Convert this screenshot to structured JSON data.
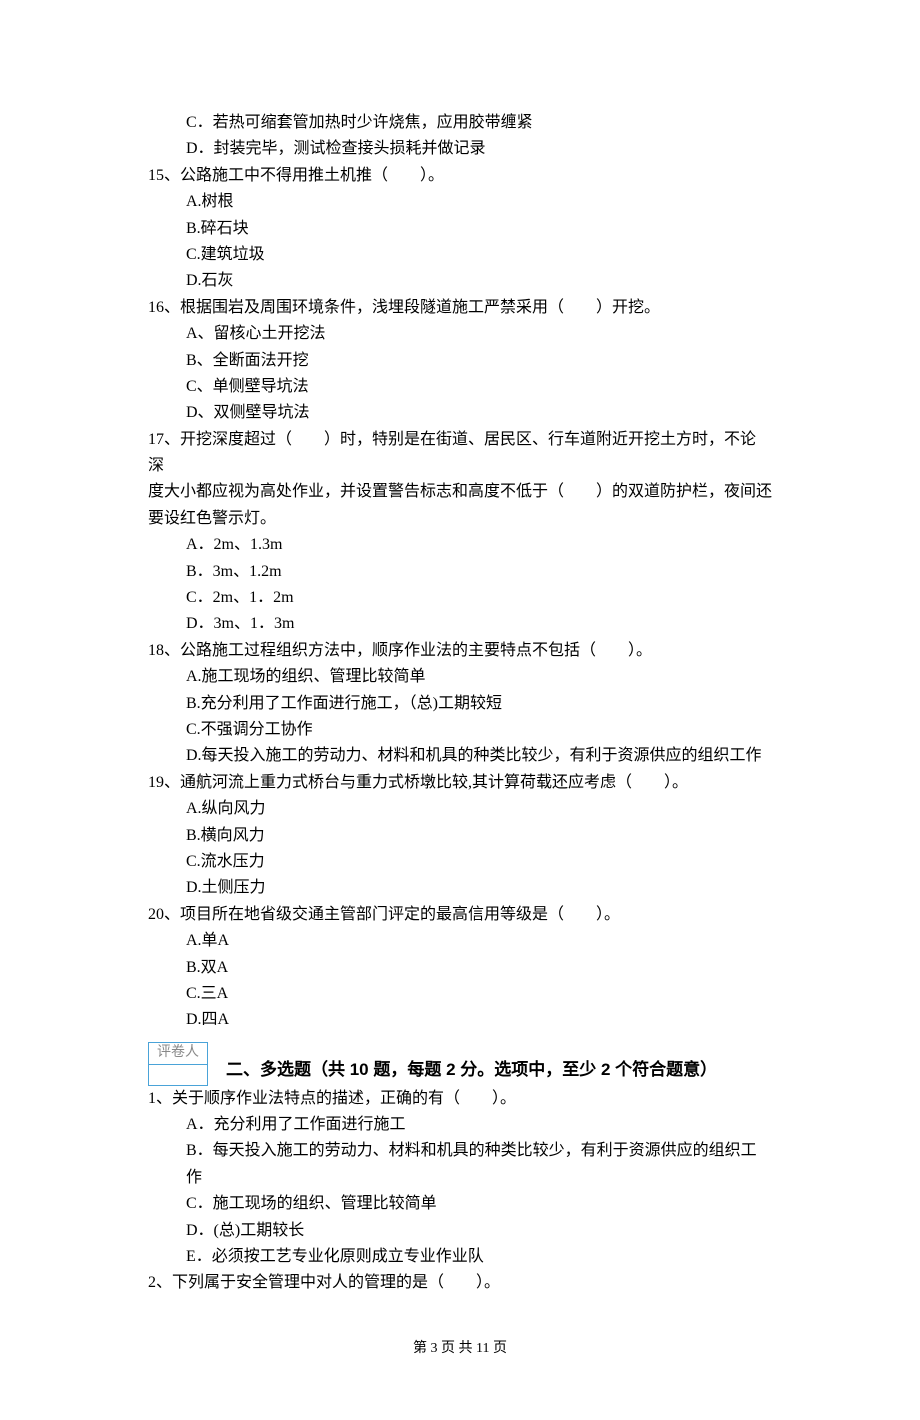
{
  "pre_options": {
    "c": "C．若热可缩套管加热时少许烧焦，应用胶带缠紧",
    "d": "D．封装完毕，测试检查接头损耗并做记录"
  },
  "q15": {
    "stem": "15、公路施工中不得用推土机推（　　）。",
    "a": "A.树根",
    "b": "B.碎石块",
    "c": "C.建筑垃圾",
    "d": "D.石灰"
  },
  "q16": {
    "stem": "16、根据围岩及周围环境条件，浅埋段隧道施工严禁采用（　　）开挖。",
    "a": "A、留核心土开挖法",
    "b": "B、全断面法开挖",
    "c": "C、单侧壁导坑法",
    "d": "D、双侧壁导坑法"
  },
  "q17": {
    "stem1": "17、开挖深度超过（　　）时，特别是在街道、居民区、行车道附近开挖土方时，不论 深",
    "stem2": "度大小都应视为高处作业，并设置警告标志和高度不低于（　　）的双道防护栏，夜间还",
    "stem3": "要设红色警示灯。",
    "a": "A．2m、1.3m",
    "b": "B．3m、1.2m",
    "c": "C．2m、1．2m",
    "d": "D．3m、1．3m"
  },
  "q18": {
    "stem": "18、公路施工过程组织方法中，顺序作业法的主要特点不包括（　　）。",
    "a": "A.施工现场的组织、管理比较简单",
    "b": "B.充分利用了工作面进行施工，（总)工期较短",
    "c": "C.不强调分工协作",
    "d": "D.每天投入施工的劳动力、材料和机具的种类比较少，有利于资源供应的组织工作"
  },
  "q19": {
    "stem": "19、通航河流上重力式桥台与重力式桥墩比较,其计算荷载还应考虑（　　）。",
    "a": "A.纵向风力",
    "b": "B.横向风力",
    "c": "C.流水压力",
    "d": "D.土侧压力"
  },
  "q20": {
    "stem": "20、项目所在地省级交通主管部门评定的最高信用等级是（　　）。",
    "a": "A.单A",
    "b": "B.双A",
    "c": "C.三A",
    "d": "D.四A"
  },
  "scorer_label": "评卷人",
  "section2_title": "二、多选题（共 10 题，每题 2 分。选项中，至少 2 个符合题意）",
  "m1": {
    "stem": "1、关于顺序作业法特点的描述，正确的有（　　）。",
    "a": "A．充分利用了工作面进行施工",
    "b": "B．每天投入施工的劳动力、材料和机具的种类比较少，有利于资源供应的组织工作",
    "c": "C．施工现场的组织、管理比较简单",
    "d": "D．(总)工期较长",
    "e": "E．必须按工艺专业化原则成立专业作业队"
  },
  "m2": {
    "stem": "2、下列属于安全管理中对人的管理的是（　　）。"
  },
  "footer": "第 3 页 共 11 页"
}
